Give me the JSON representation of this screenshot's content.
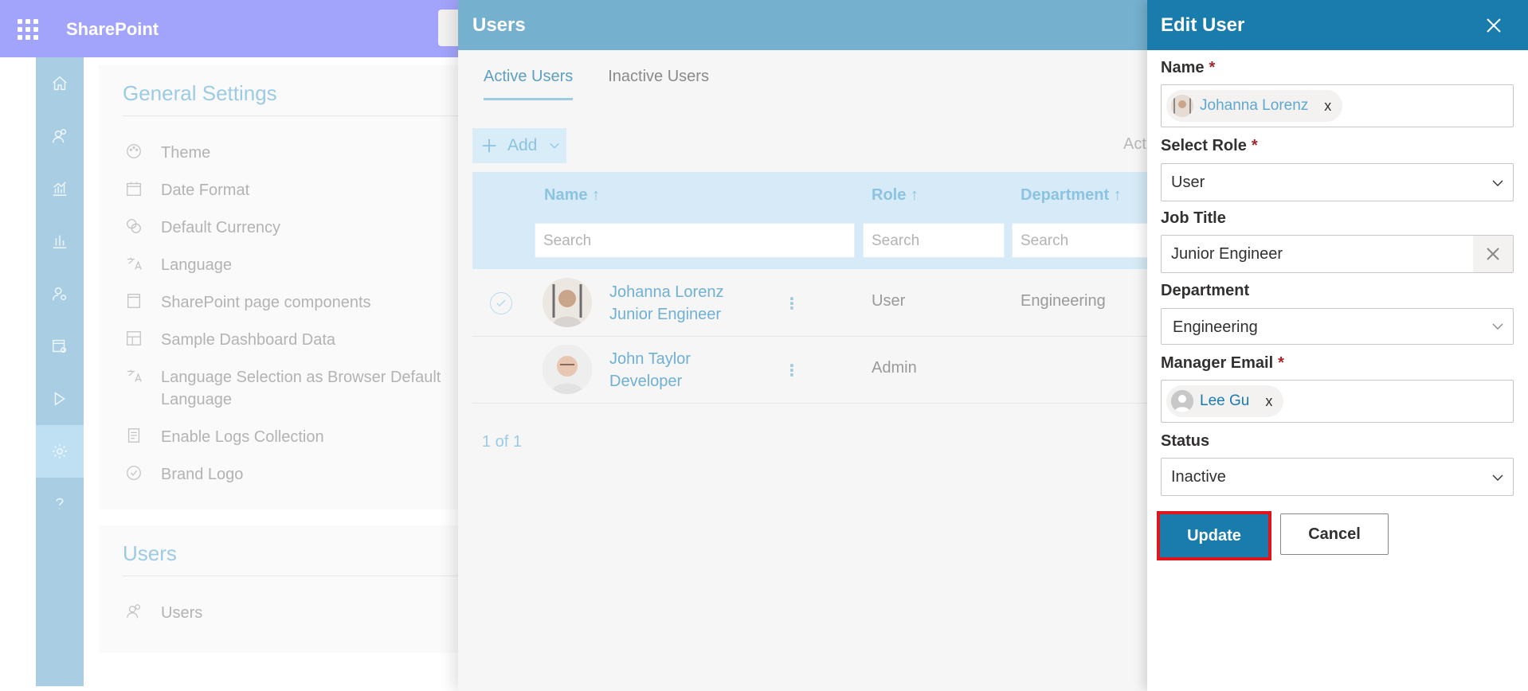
{
  "suitebar": {
    "app_name": "SharePoint",
    "waffle_icon": "app-launcher-icon"
  },
  "rail": {
    "items": [
      {
        "icon": "home-icon"
      },
      {
        "icon": "people-icon"
      },
      {
        "icon": "chart-icon"
      },
      {
        "icon": "bar-chart-icon"
      },
      {
        "icon": "user-settings-icon"
      },
      {
        "icon": "page-settings-icon"
      },
      {
        "icon": "play-icon"
      },
      {
        "icon": "gear-icon",
        "active": true
      },
      {
        "icon": "help-icon"
      }
    ]
  },
  "settings": {
    "title": "General Settings",
    "items": [
      {
        "label": "Theme",
        "icon": "palette-icon"
      },
      {
        "label": "Date Format",
        "icon": "calendar-icon"
      },
      {
        "label": "Default Currency",
        "icon": "currency-icon"
      },
      {
        "label": "Language",
        "icon": "translate-icon"
      },
      {
        "label": "SharePoint page components",
        "icon": "page-icon"
      },
      {
        "label": "Sample Dashboard Data",
        "icon": "dashboard-icon"
      },
      {
        "label": "Language Selection as Browser Default Language",
        "icon": "translate-icon"
      },
      {
        "label": "Enable Logs Collection",
        "icon": "log-icon"
      },
      {
        "label": "Brand Logo",
        "icon": "badge-icon"
      }
    ],
    "users_title": "Users",
    "users_item": "Users"
  },
  "users_panel": {
    "title": "Users",
    "tabs": [
      "Active Users",
      "Inactive Users"
    ],
    "add_label": "Add",
    "partial_label": "Act",
    "columns": {
      "name": "Name ↑",
      "role": "Role ↑",
      "department": "Department ↑"
    },
    "search_placeholder": "Search",
    "rows": [
      {
        "name": "Johanna Lorenz",
        "title": "Junior Engineer",
        "role": "User",
        "department": "Engineering",
        "selected": true
      },
      {
        "name": "John Taylor",
        "title": "Developer",
        "role": "Admin",
        "department": ""
      }
    ],
    "pager": "1 of 1"
  },
  "edit_panel": {
    "title": "Edit User",
    "name_label": "Name",
    "name_value": "Johanna Lorenz",
    "role_label": "Select Role",
    "role_value": "User",
    "job_label": "Job Title",
    "job_value": "Junior Engineer",
    "dept_label": "Department",
    "dept_value": "Engineering",
    "manager_label": "Manager Email",
    "manager_value": "Lee Gu",
    "status_label": "Status",
    "status_value": "Inactive",
    "remove_glyph": "x",
    "update_label": "Update",
    "cancel_label": "Cancel",
    "required_mark": "*"
  },
  "colors": {
    "suitebar": "#a2a4fb",
    "accent": "#1a7bad",
    "highlight_border": "#e0141b"
  }
}
